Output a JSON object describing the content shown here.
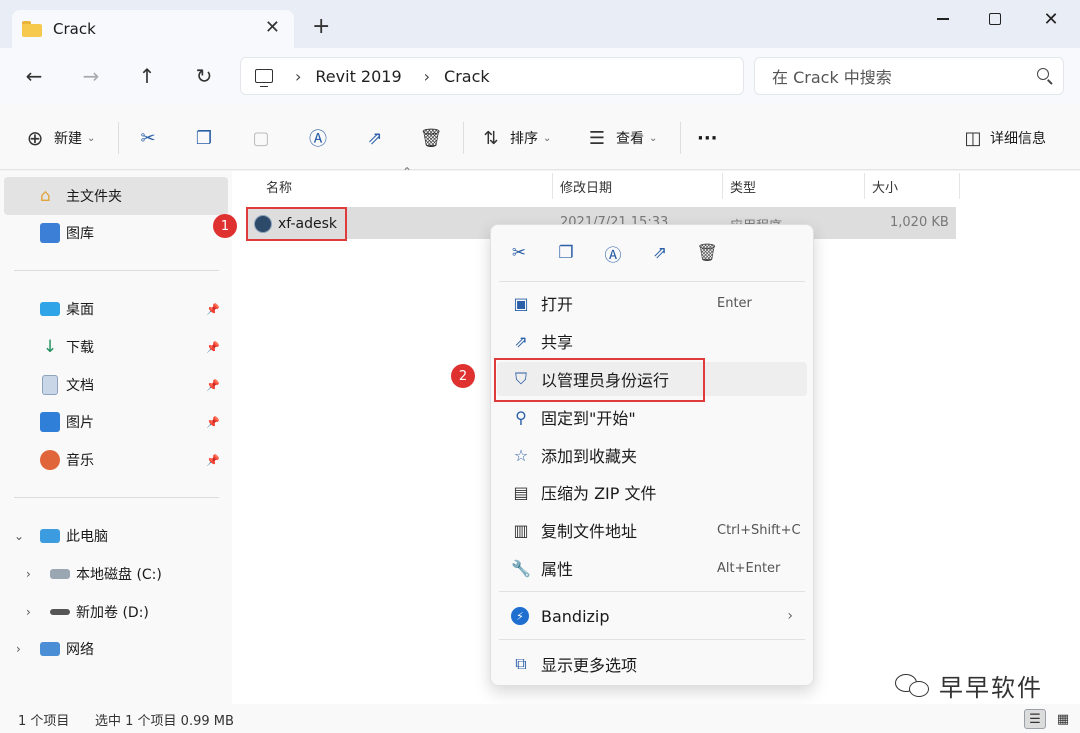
{
  "window": {
    "tab_title": "Crack",
    "tab_close": "✕",
    "new_tab": "+",
    "close_glyph": "✕"
  },
  "nav": {
    "back": "←",
    "forward": "→",
    "up": "↑",
    "refresh": "↻",
    "breadcrumb": [
      "Revit 2019",
      "Crack"
    ],
    "search_placeholder": "在 Crack 中搜索"
  },
  "toolbar": {
    "new_label": "新建",
    "sort_label": "排序",
    "view_label": "查看",
    "more_label": "···",
    "details_label": "详细信息"
  },
  "sidebar": {
    "items": [
      {
        "label": "主文件夹",
        "icon": "home-icon"
      },
      {
        "label": "图库",
        "icon": "gallery-icon"
      },
      {
        "label": "桌面",
        "icon": "desktop-icon"
      },
      {
        "label": "下载",
        "icon": "download-icon"
      },
      {
        "label": "文档",
        "icon": "document-icon"
      },
      {
        "label": "图片",
        "icon": "pictures-icon"
      },
      {
        "label": "音乐",
        "icon": "music-icon"
      },
      {
        "label": "此电脑",
        "icon": "computer-icon"
      },
      {
        "label": "本地磁盘 (C:)",
        "icon": "drive-c-icon"
      },
      {
        "label": "新加卷 (D:)",
        "icon": "drive-d-icon"
      },
      {
        "label": "网络",
        "icon": "network-icon"
      }
    ]
  },
  "columns": [
    "名称",
    "修改日期",
    "类型",
    "大小"
  ],
  "files": [
    {
      "name": "xf-adesk",
      "modified": "2021/7/21 15:33",
      "type": "应用程序",
      "size": "1,020 KB"
    }
  ],
  "badges": [
    "1",
    "2"
  ],
  "context_menu": {
    "items": [
      {
        "label": "打开",
        "shortcut": "Enter",
        "icon": "open-icon"
      },
      {
        "label": "共享",
        "shortcut": "",
        "icon": "share-icon"
      },
      {
        "label": "以管理员身份运行",
        "shortcut": "",
        "icon": "shield-icon"
      },
      {
        "label": "固定到\"开始\"",
        "shortcut": "",
        "icon": "pin-icon"
      },
      {
        "label": "添加到收藏夹",
        "shortcut": "",
        "icon": "star-icon"
      },
      {
        "label": "压缩为 ZIP 文件",
        "shortcut": "",
        "icon": "zip-icon"
      },
      {
        "label": "复制文件地址",
        "shortcut": "Ctrl+Shift+C",
        "icon": "copy-path-icon"
      },
      {
        "label": "属性",
        "shortcut": "Alt+Enter",
        "icon": "wrench-icon"
      },
      {
        "label": "Bandizip",
        "shortcut": "",
        "icon": "bandizip-icon"
      },
      {
        "label": "显示更多选项",
        "shortcut": "",
        "icon": "more-options-icon"
      }
    ]
  },
  "status": {
    "count": "1 个项目",
    "selection": "选中 1 个项目  0.99 MB"
  },
  "watermark": "早早软件",
  "colors": {
    "accent": "#2b5fa8",
    "highlight_red": "#e03b3b",
    "badge_red": "#e03131"
  }
}
